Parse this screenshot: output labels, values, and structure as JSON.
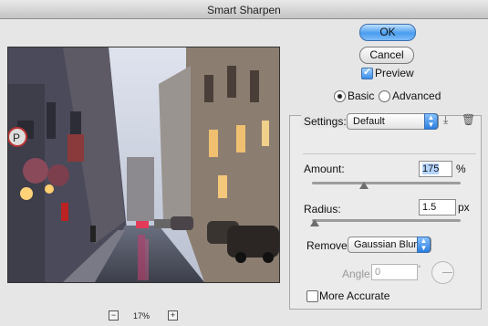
{
  "window": {
    "title": "Smart Sharpen"
  },
  "preview": {
    "zoom_out": "−",
    "zoom_in": "+",
    "zoom_level": "17%"
  },
  "buttons": {
    "ok": "OK",
    "cancel": "Cancel"
  },
  "preview_checkbox": {
    "label": "Preview",
    "checked": true
  },
  "mode": {
    "basic": "Basic",
    "advanced": "Advanced",
    "selected": "Basic"
  },
  "settings": {
    "label": "Settings:",
    "value": "Default"
  },
  "amount": {
    "label": "Amount:",
    "value": "175",
    "unit": "%",
    "level": 0.35
  },
  "radius": {
    "label": "Radius:",
    "value": "1.5",
    "unit": "px",
    "level": 0.02
  },
  "remove": {
    "label": "Remove:",
    "value": "Gaussian Blur"
  },
  "angle": {
    "label": "Angle:",
    "value": "0",
    "unit": "°"
  },
  "more_accurate": {
    "label": "More Accurate",
    "checked": false
  },
  "icons": {
    "save": "save-settings-icon",
    "delete": "trash-icon"
  }
}
